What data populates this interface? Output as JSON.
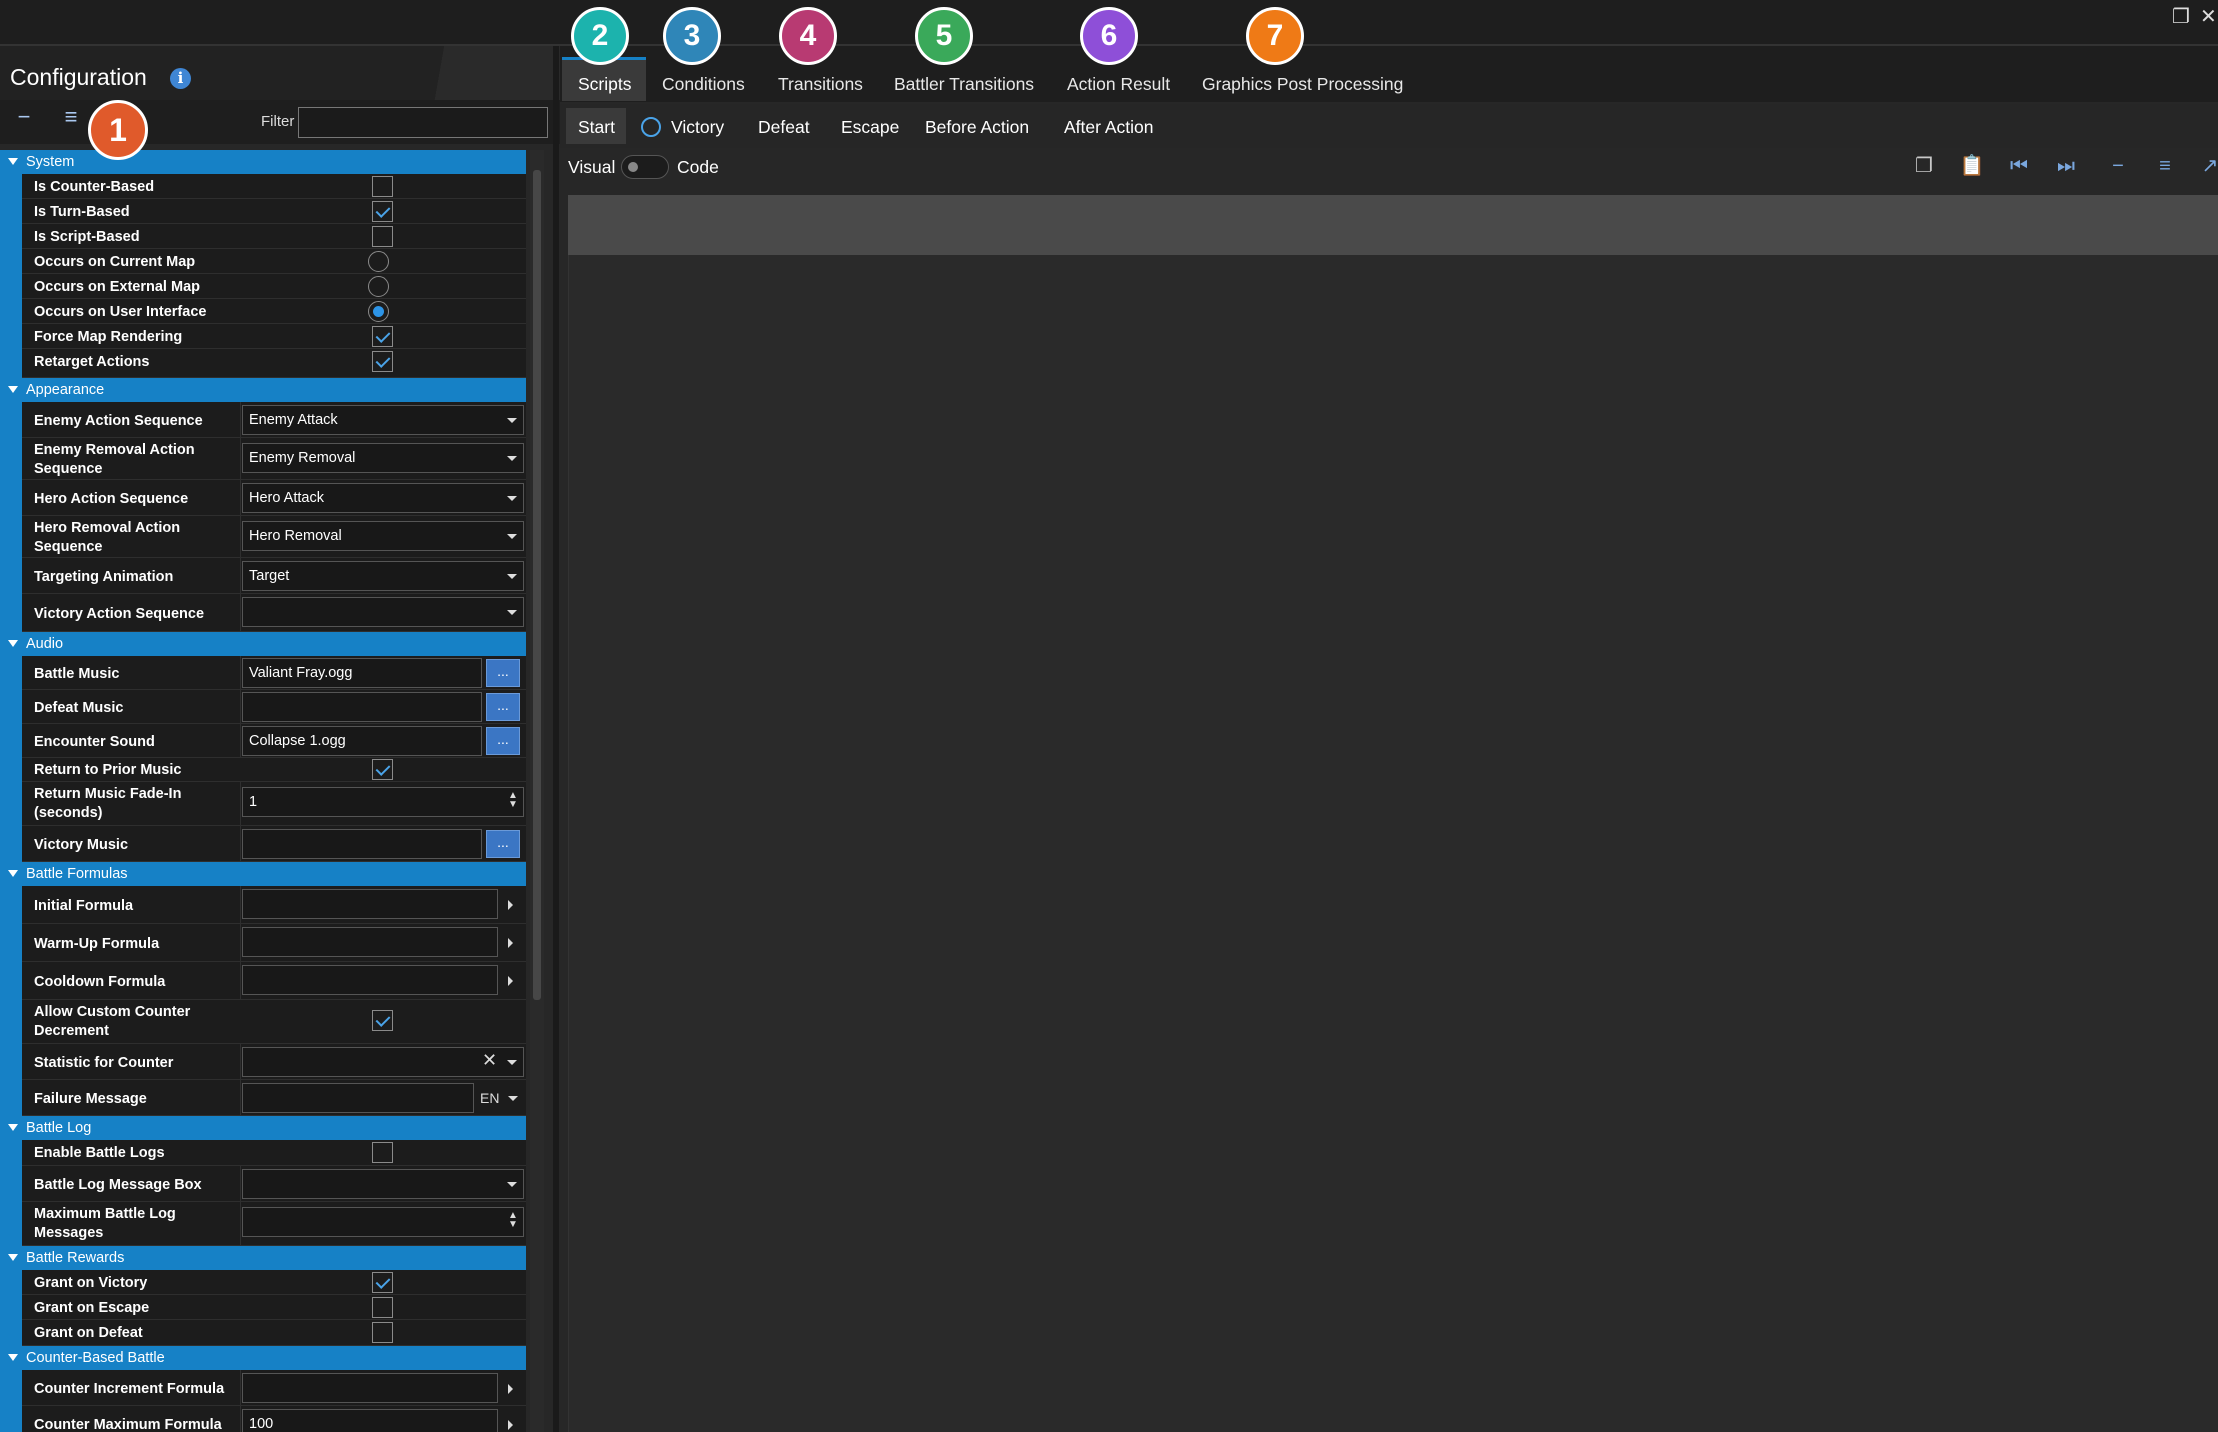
{
  "window": {
    "restore_glyph": "❐",
    "close_glyph": "✕"
  },
  "left_panel": {
    "title": "Configuration",
    "info_glyph": "i",
    "collapse_glyph": "−",
    "expand_glyph": "≡",
    "filter_label": "Filter",
    "filter_value": ""
  },
  "badges": [
    "1",
    "2",
    "3",
    "4",
    "5",
    "6",
    "7"
  ],
  "badge_colors": {
    "1": "#e05a2b",
    "2": "#1cb3ad",
    "3": "#2f86b8",
    "4": "#b83a72",
    "5": "#3aa95a",
    "6": "#8e4fd8",
    "7": "#ef7a16"
  },
  "sections": {
    "system": "System",
    "appearance": "Appearance",
    "audio": "Audio",
    "battle_formulas": "Battle Formulas",
    "battle_log": "Battle Log",
    "battle_rewards": "Battle Rewards",
    "counter_based": "Counter-Based Battle"
  },
  "system": {
    "is_counter_based": {
      "label": "Is Counter-Based",
      "checked": false
    },
    "is_turn_based": {
      "label": "Is Turn-Based",
      "checked": true
    },
    "is_script_based": {
      "label": "Is Script-Based",
      "checked": false
    },
    "occurs_current_map": {
      "label": "Occurs on Current Map",
      "selected": false
    },
    "occurs_external_map": {
      "label": "Occurs on External Map",
      "selected": false
    },
    "occurs_user_interface": {
      "label": "Occurs on User Interface",
      "selected": true
    },
    "force_map_rendering": {
      "label": "Force Map Rendering",
      "checked": true
    },
    "retarget_actions": {
      "label": "Retarget Actions",
      "checked": true
    }
  },
  "appearance": {
    "enemy_action_sequence": {
      "label": "Enemy Action Sequence",
      "value": "Enemy Attack"
    },
    "enemy_removal_action_sequence": {
      "label": "Enemy Removal Action Sequence",
      "value": "Enemy Removal"
    },
    "hero_action_sequence": {
      "label": "Hero Action Sequence",
      "value": "Hero Attack"
    },
    "hero_removal_action_sequence": {
      "label": "Hero Removal Action Sequence",
      "value": "Hero Removal"
    },
    "targeting_animation": {
      "label": "Targeting Animation",
      "value": "Target"
    },
    "victory_action_sequence": {
      "label": "Victory Action Sequence",
      "value": ""
    }
  },
  "audio": {
    "battle_music": {
      "label": "Battle Music",
      "value": "Valiant Fray.ogg"
    },
    "defeat_music": {
      "label": "Defeat Music",
      "value": ""
    },
    "encounter_sound": {
      "label": "Encounter Sound",
      "value": "Collapse 1.ogg"
    },
    "return_prior_music": {
      "label": "Return to Prior Music",
      "checked": true
    },
    "return_music_fade_in": {
      "label": "Return Music Fade-In (seconds)",
      "value": "1"
    },
    "victory_music": {
      "label": "Victory Music",
      "value": ""
    },
    "browse_label": "..."
  },
  "battle_formulas": {
    "initial_formula": {
      "label": "Initial Formula",
      "value": ""
    },
    "warm_up_formula": {
      "label": "Warm-Up Formula",
      "value": ""
    },
    "cooldown_formula": {
      "label": "Cooldown Formula",
      "value": ""
    },
    "allow_custom_counter_decrement": {
      "label": "Allow Custom Counter Decrement",
      "checked": true
    },
    "statistic_for_counter": {
      "label": "Statistic for Counter",
      "value": "",
      "clear_glyph": "✕"
    },
    "failure_message": {
      "label": "Failure Message",
      "value": "",
      "language": "EN"
    }
  },
  "battle_log": {
    "enable_battle_logs": {
      "label": "Enable Battle Logs",
      "checked": false
    },
    "battle_log_message_box": {
      "label": "Battle Log Message Box",
      "value": ""
    },
    "maximum_battle_log_messages": {
      "label": "Maximum Battle Log Messages",
      "value": ""
    }
  },
  "battle_rewards": {
    "grant_on_victory": {
      "label": "Grant on Victory",
      "checked": true
    },
    "grant_on_escape": {
      "label": "Grant on Escape",
      "checked": false
    },
    "grant_on_defeat": {
      "label": "Grant on Defeat",
      "checked": false
    }
  },
  "counter_based": {
    "counter_increment_formula": {
      "label": "Counter Increment Formula",
      "value": ""
    },
    "counter_maximum_formula": {
      "label": "Counter Maximum Formula",
      "value": "100"
    }
  },
  "main_tabs": [
    "Scripts",
    "Conditions",
    "Transitions",
    "Battler Transitions",
    "Action Result",
    "Graphics Post Processing"
  ],
  "active_tab": "Scripts",
  "sub_tabs": [
    "Start",
    "Victory",
    "Defeat",
    "Escape",
    "Before Action",
    "After Action"
  ],
  "active_sub_tab": "Start",
  "editor_mode": {
    "visual_label": "Visual",
    "code_label": "Code"
  },
  "toolbar_icons": [
    "copy-icon",
    "paste-icon",
    "move-first-icon",
    "move-last-icon",
    "collapse-all-icon",
    "expand-all-icon",
    "external-icon"
  ],
  "toolbar_glyphs": [
    "❐",
    "📋",
    "⏮",
    "⏭",
    "−",
    "≡",
    "↗"
  ]
}
